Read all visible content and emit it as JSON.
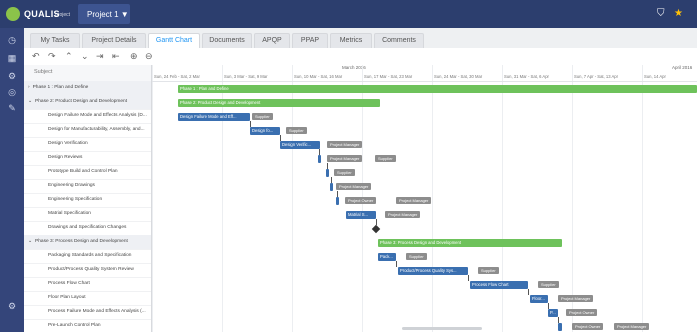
{
  "app": {
    "brand": "QUALIS",
    "brand_sub": "project",
    "project_selector": "Project 1 ▼"
  },
  "header_icons": [
    "filter-icon",
    "star-icon"
  ],
  "sidebar_icons": [
    "dashboard-icon",
    "calendar-icon",
    "settings-icon",
    "target-icon",
    "edit-icon",
    "settings-bottom-icon"
  ],
  "tabs": [
    {
      "label": "My Tasks"
    },
    {
      "label": "Project Details"
    },
    {
      "label": "Gantt Chart"
    },
    {
      "label": "Documents"
    },
    {
      "label": "APQP"
    },
    {
      "label": "PPAP"
    },
    {
      "label": "Metrics"
    },
    {
      "label": "Comments"
    }
  ],
  "toolbar_icons": [
    "undo-icon",
    "redo-icon",
    "expand-icon",
    "collapse-icon",
    "indent-icon",
    "outdent-icon",
    "zoom-in-icon",
    "zoom-out-icon"
  ],
  "grid": {
    "subject_header": "Subject",
    "month_1": "March 2016",
    "month_2": "April 2016",
    "weeks": [
      "Sun, 24 Feb - Sat, 2 Mar",
      "Sun, 3 Mar - Sat, 9 Mar",
      "Sun, 10 Mar - Sat, 16 Mar",
      "Sun, 17 Mar - Sat, 23 Mar",
      "Sun, 24 Mar - Sat, 30 Mar",
      "Sun, 31 Mar - Sat, 6 Apr",
      "Sun, 7 Apr - Sat, 13 Apr",
      "Sun, 14 Apr"
    ],
    "rows": [
      {
        "text": "Phase 1 : Plan and Define",
        "phase": true,
        "prefix": "›"
      },
      {
        "text": "Phase 2: Product Design and Development",
        "phase": true,
        "prefix": "⌄"
      },
      {
        "text": "Design Failure Mode and Effects Analysis (D...",
        "phase": false
      },
      {
        "text": "Design for Manufacturability, Assembly, and...",
        "phase": false
      },
      {
        "text": "Design Verification",
        "phase": false
      },
      {
        "text": "Design Reviews",
        "phase": false
      },
      {
        "text": "Prototype Build and Control Plan",
        "phase": false
      },
      {
        "text": "Engineering Drawings",
        "phase": false
      },
      {
        "text": "Engineering Specification",
        "phase": false
      },
      {
        "text": "Matrial Specification",
        "phase": false
      },
      {
        "text": "Drawings and Specification Changes",
        "phase": false
      },
      {
        "text": "Phase 3: Process Design and Development",
        "phase": true,
        "prefix": "⌄"
      },
      {
        "text": "Packaging Standards and Specification",
        "phase": false
      },
      {
        "text": "Product/Process Quality System Review",
        "phase": false
      },
      {
        "text": "Process Flow Chart",
        "phase": false
      },
      {
        "text": "Floor Plan Layout",
        "phase": false
      },
      {
        "text": "Process Failure Mode and Effects Analysis (...",
        "phase": false
      },
      {
        "text": "Pre-Launch Control Plan",
        "phase": false
      }
    ]
  },
  "bars": {
    "phase1": "Phase 1 : Plan and Define",
    "phase2": "Phase 2: Product Design and Development",
    "dfmea": "Design Failure Mode and Eff...",
    "dfm": "Design fo...",
    "dv": "Design Verific...",
    "ms": "Matrial S...",
    "phase3": "Phase 3: Process Design and Development",
    "pack": "Pack...",
    "pqs": "Product/Process Quality Sys...",
    "pfc": "Process Flow Chart",
    "floor": "Floor...",
    "pfmea": "P..."
  },
  "resources": {
    "supplier": "Supplier",
    "pm": "Project Manager",
    "owner": "Project Owner"
  },
  "colors": {
    "header": "#2c3e6e",
    "sidebar": "#34457a",
    "summary_bar": "#6ec25b",
    "task_bar": "#3a6fb0",
    "resource": "#8d8d8d",
    "active_tab": "#2196f3"
  }
}
